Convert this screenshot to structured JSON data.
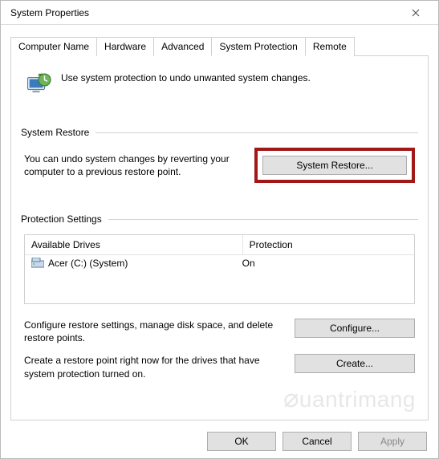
{
  "window": {
    "title": "System Properties"
  },
  "tabs": {
    "computer_name": "Computer Name",
    "hardware": "Hardware",
    "advanced": "Advanced",
    "system_protection": "System Protection",
    "remote": "Remote"
  },
  "intro": "Use system protection to undo unwanted system changes.",
  "restore": {
    "heading": "System Restore",
    "text": "You can undo system changes by reverting your computer to a previous restore point.",
    "button": "System Restore..."
  },
  "protection": {
    "heading": "Protection Settings",
    "cols": {
      "drives": "Available Drives",
      "protection": "Protection"
    },
    "rows": [
      {
        "name": "Acer (C:) (System)",
        "status": "On"
      }
    ],
    "configure_text": "Configure restore settings, manage disk space, and delete restore points.",
    "configure_btn": "Configure...",
    "create_text": "Create a restore point right now for the drives that have system protection turned on.",
    "create_btn": "Create..."
  },
  "buttons": {
    "ok": "OK",
    "cancel": "Cancel",
    "apply": "Apply"
  },
  "watermark": "uantrimang"
}
